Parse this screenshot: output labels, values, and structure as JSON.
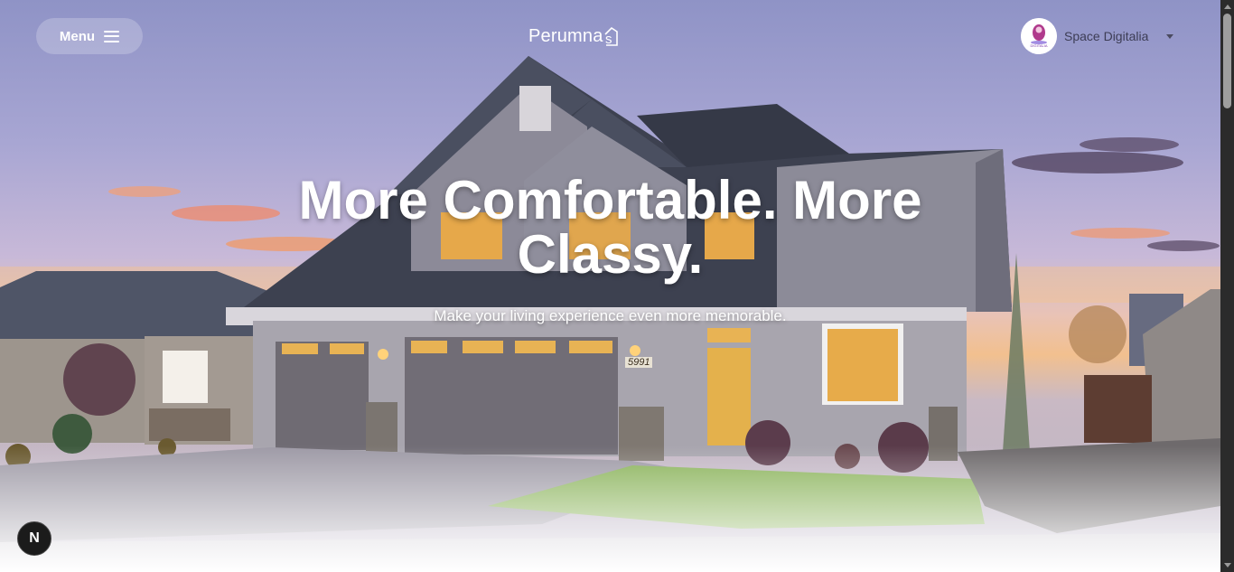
{
  "header": {
    "menu_label": "Menu",
    "brand": "Perumna",
    "brand_suffix": "s",
    "account": {
      "name": "Space Digitalia",
      "avatar_text": "DIGITALIA"
    }
  },
  "hero": {
    "headline_line1": "More Comfortable. More",
    "headline_line2": "Classy.",
    "subheadline": "Make your living experience even more memorable.",
    "house_number": "5991"
  },
  "floating": {
    "n_label": "N"
  },
  "colors": {
    "overlay_text": "#ffffff",
    "account_text": "#3d3d55",
    "scrollbar_track": "#2b2b2b",
    "scrollbar_thumb": "#9e9e9e"
  },
  "icons": [
    "hamburger-icon",
    "house-icon",
    "chevron-down-icon",
    "scroll-up-arrow-icon",
    "scroll-down-arrow-icon"
  ]
}
